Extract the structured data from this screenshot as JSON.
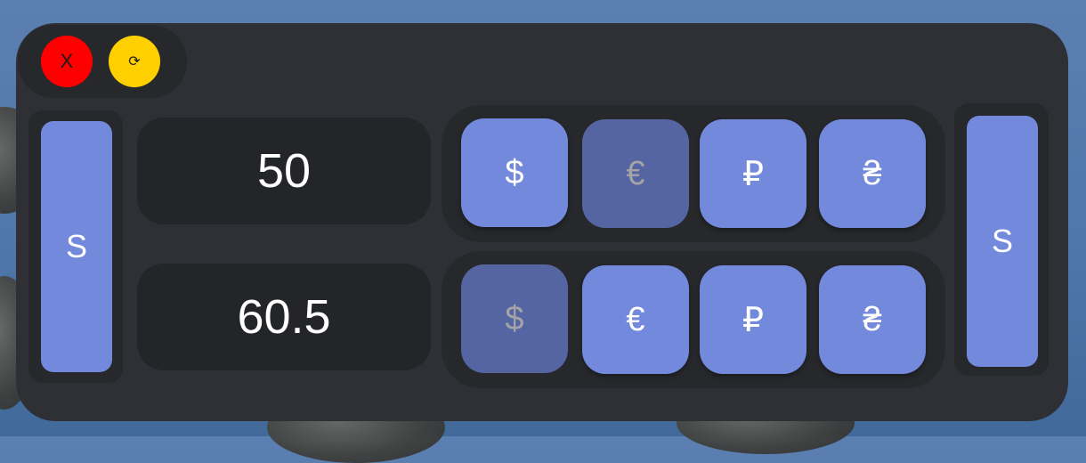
{
  "controls": {
    "close_label": "X",
    "refresh_label": "⟳"
  },
  "swap": {
    "left_label": "S",
    "right_label": "S"
  },
  "amounts": {
    "from_value": "50",
    "to_value": "60.5"
  },
  "currency_rows": {
    "from": {
      "options": [
        "$",
        "€",
        "₽",
        "₴"
      ],
      "selected": "€"
    },
    "to": {
      "options": [
        "$",
        "€",
        "₽",
        "₴"
      ],
      "selected": "$"
    }
  },
  "colors": {
    "button": "#7389dc",
    "button_selected": "#5465a2",
    "panel": "#2e3035",
    "close": "#ff0000",
    "refresh": "#ffd000"
  }
}
